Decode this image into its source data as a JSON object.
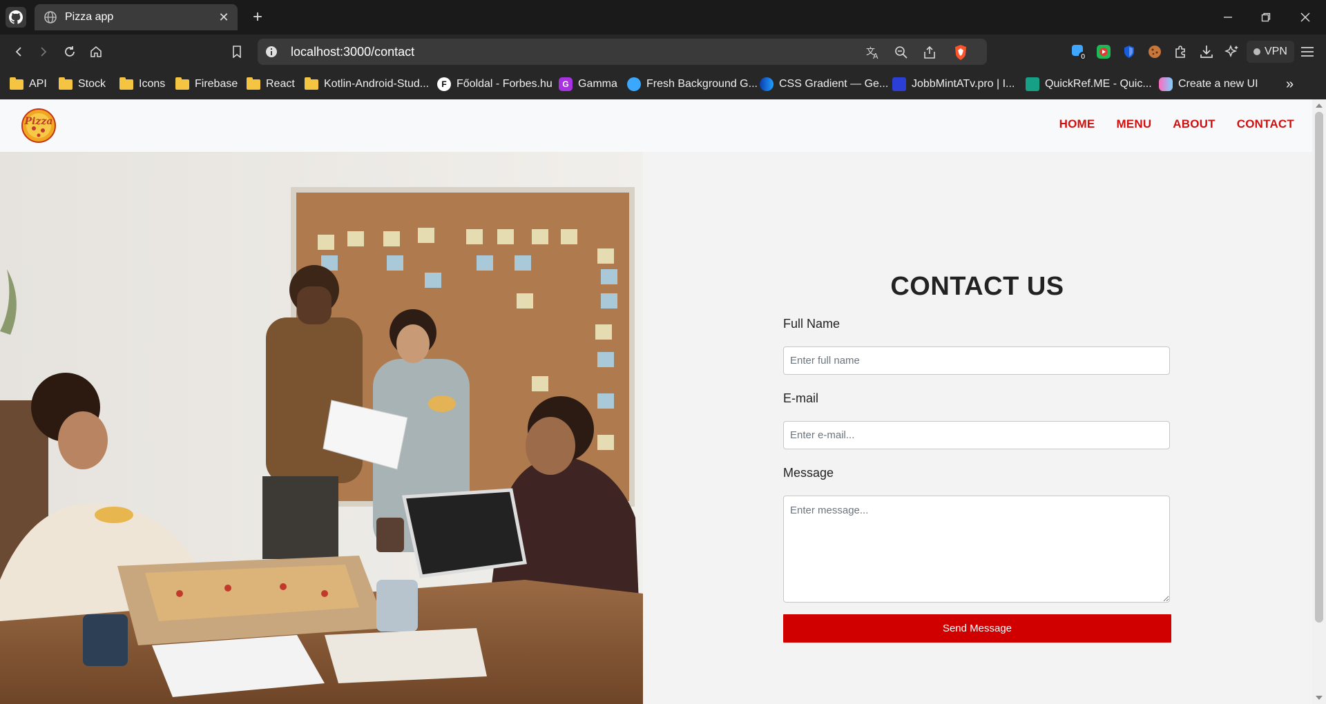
{
  "browser": {
    "tab_title": "Pizza app",
    "tab_close": "✕",
    "new_tab": "+",
    "url": "localhost:3000/contact",
    "vpn_label": "VPN",
    "extension_badge": "0",
    "more": "»"
  },
  "bookmarks": [
    {
      "label": "API",
      "icon": "folder"
    },
    {
      "label": "Stock",
      "icon": "folder"
    },
    {
      "label": "Icons",
      "icon": "folder"
    },
    {
      "label": "Firebase",
      "icon": "folder"
    },
    {
      "label": "React",
      "icon": "folder"
    },
    {
      "label": "Kotlin-Android-Stud...",
      "icon": "folder"
    },
    {
      "label": "Főoldal - Forbes.hu",
      "icon": "forbes-icon"
    },
    {
      "label": "Gamma",
      "icon": "gamma-icon"
    },
    {
      "label": "Fresh Background G...",
      "icon": "fresh-background-icon"
    },
    {
      "label": "CSS Gradient — Ge...",
      "icon": "css-gradient-icon"
    },
    {
      "label": "JobbMintATv.pro | I...",
      "icon": "jobbmintatv-icon"
    },
    {
      "label": "QuickRef.ME - Quic...",
      "icon": "quickref-icon"
    },
    {
      "label": "Create a new UI",
      "icon": "uizard-icon"
    }
  ],
  "site": {
    "logo_text": "Pizza",
    "nav": [
      "HOME",
      "MENU",
      "ABOUT",
      "CONTACT"
    ]
  },
  "contact": {
    "heading": "CONTACT US",
    "full_name_label": "Full Name",
    "full_name_placeholder": "Enter full name",
    "email_label": "E-mail",
    "email_placeholder": "Enter e-mail...",
    "message_label": "Message",
    "message_placeholder": "Enter message...",
    "submit": "Send Message"
  },
  "colors": {
    "accent": "#d10000",
    "nav_link": "#d10f0f",
    "browser_dark": "#1a1a1a"
  }
}
